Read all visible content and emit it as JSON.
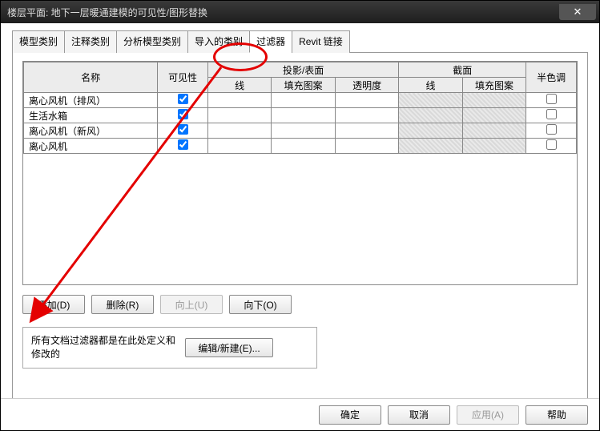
{
  "window": {
    "title": "楼层平面: 地下一层暖通建模的可见性/图形替换"
  },
  "tabs": {
    "items": [
      {
        "label": "模型类别"
      },
      {
        "label": "注释类别"
      },
      {
        "label": "分析模型类别"
      },
      {
        "label": "导入的类别"
      },
      {
        "label": "过滤器"
      },
      {
        "label": "Revit 链接"
      }
    ],
    "active_index": 4
  },
  "grid": {
    "headers": {
      "name": "名称",
      "visibility": "可见性",
      "projection_group": "投影/表面",
      "cut_group": "截面",
      "halftone": "半色调",
      "line": "线",
      "pattern": "填充图案",
      "transparency": "透明度"
    },
    "rows": [
      {
        "name": "离心风机（排风）",
        "visible": true,
        "halftone": false
      },
      {
        "name": "生活水箱",
        "visible": true,
        "halftone": false
      },
      {
        "name": "离心风机（新风）",
        "visible": true,
        "halftone": false
      },
      {
        "name": "离心风机",
        "visible": true,
        "halftone": false
      }
    ]
  },
  "buttons": {
    "add": "添加(D)",
    "remove": "删除(R)",
    "up": "向上(U)",
    "down": "向下(O)",
    "edit_new": "编辑/新建(E)...",
    "ok": "确定",
    "cancel": "取消",
    "apply": "应用(A)",
    "help": "帮助"
  },
  "note": "所有文档过滤器都是在此处定义和修改的"
}
